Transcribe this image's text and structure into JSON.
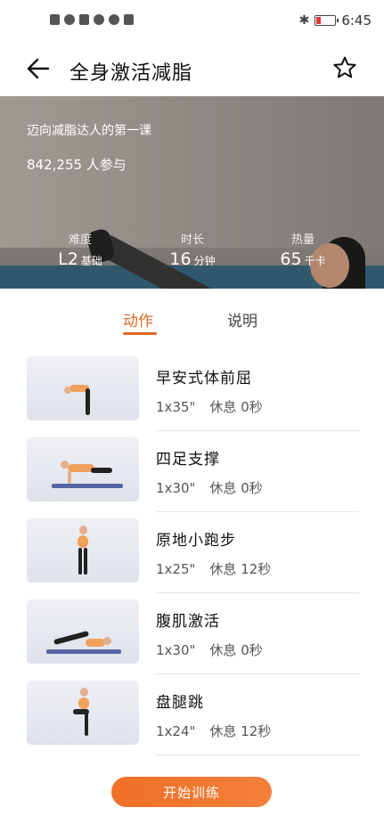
{
  "status_bar": {
    "time": "6:45"
  },
  "header": {
    "title": "全身激活减脂"
  },
  "hero": {
    "subtitle": "迈向减脂达人的第一课",
    "participants": "842,255 人参与",
    "stats": [
      {
        "label": "难度",
        "value": "L2",
        "unit": "基础"
      },
      {
        "label": "时长",
        "value": "16",
        "unit": "分钟"
      },
      {
        "label": "热量",
        "value": "65",
        "unit": "千卡"
      }
    ]
  },
  "tabs": [
    {
      "label": "动作",
      "active": true
    },
    {
      "label": "说明",
      "active": false
    }
  ],
  "exercises": [
    {
      "name": "早安式体前屈",
      "reps": "1x35\"",
      "rest": "休息 0秒"
    },
    {
      "name": "四足支撑",
      "reps": "1x30\"",
      "rest": "休息 0秒"
    },
    {
      "name": "原地小跑步",
      "reps": "1x25\"",
      "rest": "休息 12秒"
    },
    {
      "name": "腹肌激活",
      "reps": "1x30\"",
      "rest": "休息 0秒"
    },
    {
      "name": "盘腿跳",
      "reps": "1x24\"",
      "rest": "休息 12秒"
    }
  ],
  "start_button": "开始训练",
  "colors": {
    "accent": "#e0691f",
    "button": "#ef6f27"
  }
}
